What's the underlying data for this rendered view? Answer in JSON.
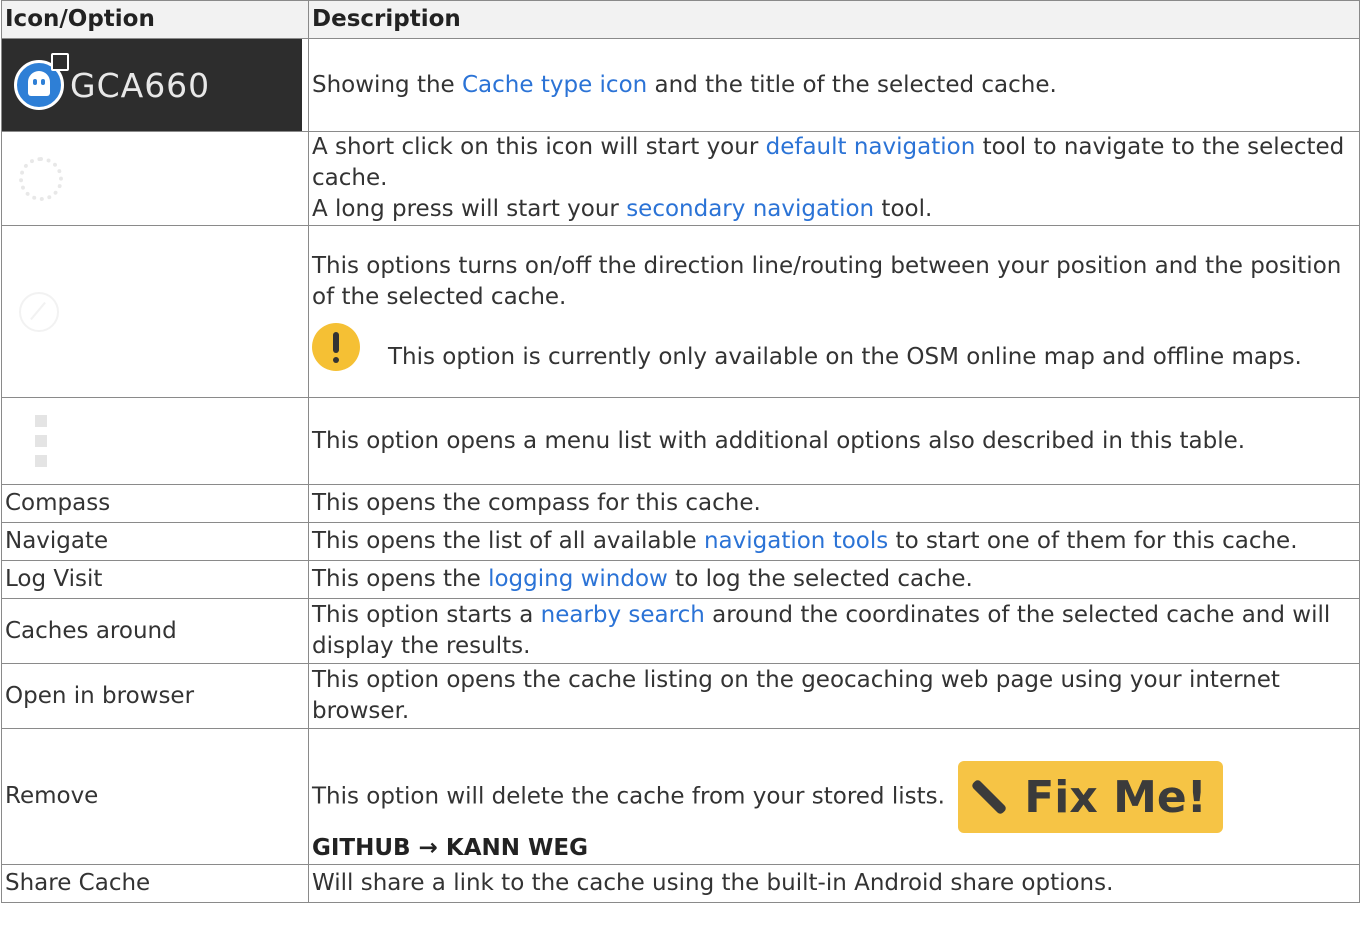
{
  "table": {
    "col_icon": "Icon/Option",
    "col_desc": "Description"
  },
  "rows": {
    "title": {
      "cache_name": "GCA660",
      "t1": "Showing the ",
      "link": "Cache type icon",
      "t2": " and the title of the selected cache."
    },
    "navigation": {
      "t1": "A short click on this icon will start your ",
      "link1": "default navigation",
      "t2": " tool to navigate to the selected cache.",
      "t3": "A long press will start your ",
      "link2": "secondary navigation",
      "t4": " tool."
    },
    "direction": {
      "t1": "This options turns on/off the direction line/routing between your position and the position of the selected cache.",
      "warning": "This option is currently only available on the OSM online map and offline maps."
    },
    "menu": {
      "t1": "This option opens a menu list with additional options also described in this table."
    },
    "compass": {
      "option": "Compass",
      "t1": "This opens the compass for this cache."
    },
    "navigate": {
      "option": "Navigate",
      "t1": "This opens the list of all available ",
      "link": "navigation tools",
      "t2": " to start one of them for this cache."
    },
    "log": {
      "option": "Log Visit",
      "t1": "This opens the ",
      "link": "logging window",
      "t2": " to log the selected cache."
    },
    "around": {
      "option": "Caches around",
      "t1": "This option starts a ",
      "link": "nearby search",
      "t2": " around the coordinates of the selected cache and will display the results."
    },
    "browser": {
      "option": "Open in browser",
      "t1": "This option opens the cache listing on the geocaching web page using your internet browser."
    },
    "remove": {
      "option": "Remove",
      "t1": "This option will delete the cache from your stored lists.",
      "fixme": "Fix Me!",
      "note": "GITHUB → KANN WEG"
    },
    "share": {
      "option": "Share Cache",
      "t1": "Will share a link to the cache using the built-in Android share options."
    }
  },
  "colors": {
    "link": "#2b73d6",
    "fixme_bg": "#f6c445",
    "warning": "#f5c034",
    "header_bg": "#f2f2f2",
    "cache_icon": "#2e7fd6"
  },
  "icons": [
    "cache-type-ghost-icon",
    "stored-floppy-icon",
    "navigation-icon",
    "direction-line-icon",
    "more-menu-icon",
    "warning-icon",
    "wrench-icon"
  ]
}
